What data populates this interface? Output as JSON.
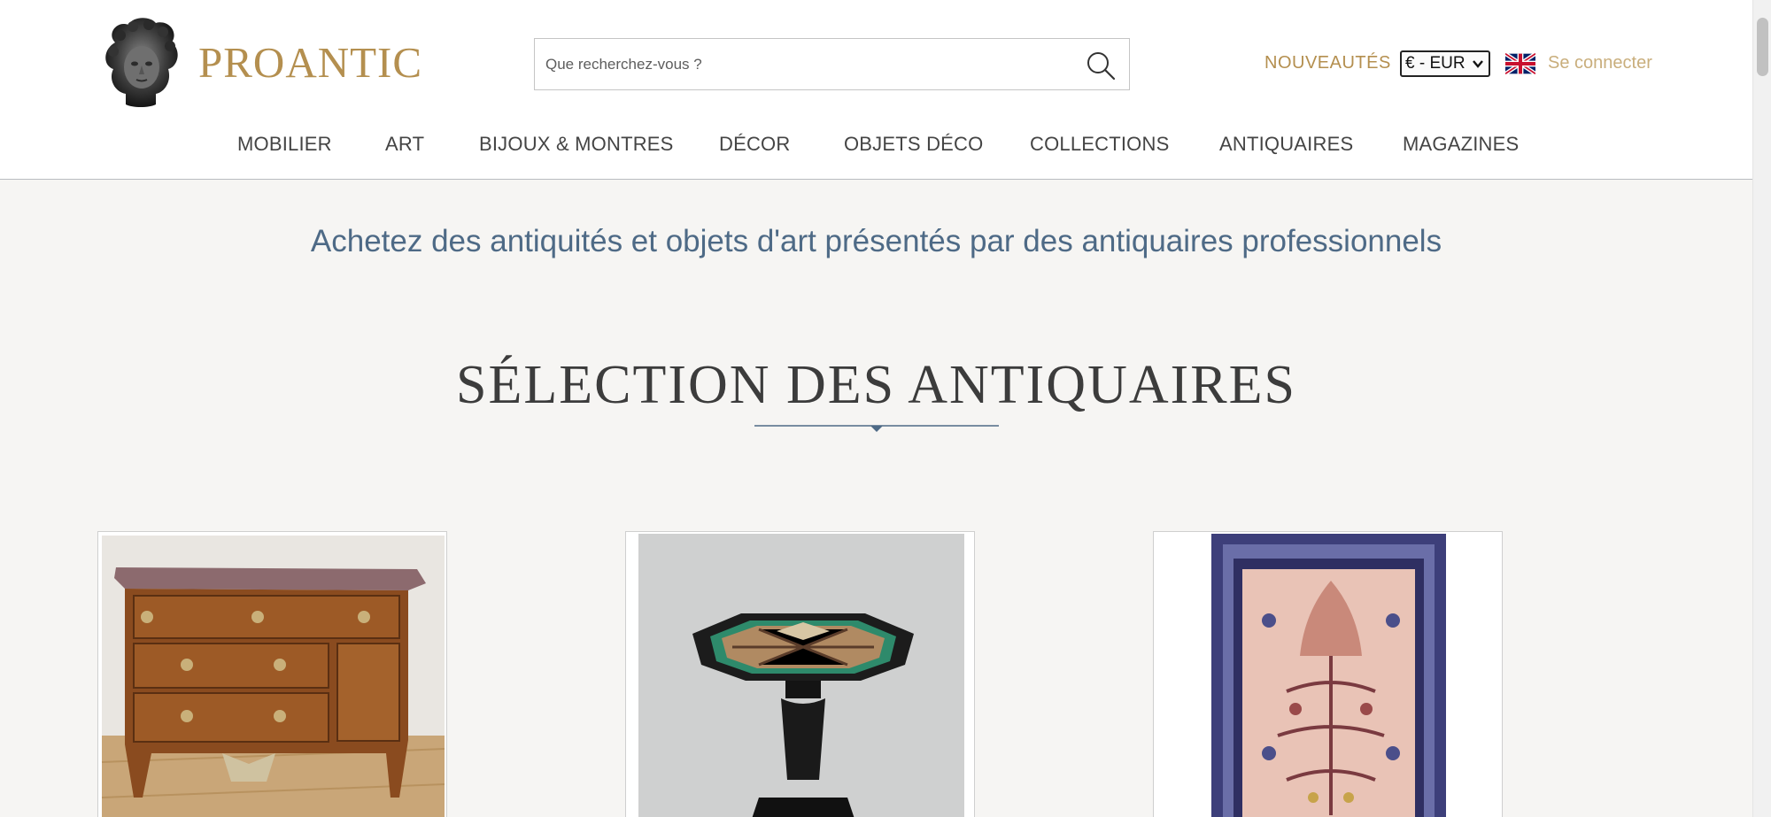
{
  "brand": {
    "name": "PROANTIC"
  },
  "search": {
    "placeholder": "Que recherchez-vous ?"
  },
  "header": {
    "new_label": "NOUVEAUTÉS",
    "currency_selected": "€ - EUR",
    "language_flag": "uk-flag-icon",
    "login_label": "Se connecter"
  },
  "nav": {
    "items": [
      {
        "label": "MOBILIER"
      },
      {
        "label": "ART"
      },
      {
        "label": "BIJOUX & MONTRES"
      },
      {
        "label": "DÉCOR"
      },
      {
        "label": "OBJETS DÉCO"
      },
      {
        "label": "COLLECTIONS"
      },
      {
        "label": "ANTIQUAIRES"
      },
      {
        "label": "MAGAZINES"
      }
    ]
  },
  "main": {
    "tagline": "Achetez des antiquités et objets d'art présentés par des antiquaires professionnels",
    "section_title": "SÉLECTION DES ANTIQUAIRES"
  },
  "colors": {
    "accent_gold": "#b48f4f",
    "login_gold": "#c9ae7c",
    "tagline_blue": "#4e6a86",
    "divider_blue": "#4e6a86",
    "page_bg": "#f6f5f3"
  },
  "icons": [
    "logo-bust-icon",
    "search-icon",
    "chevron-down-icon",
    "uk-flag-icon"
  ]
}
